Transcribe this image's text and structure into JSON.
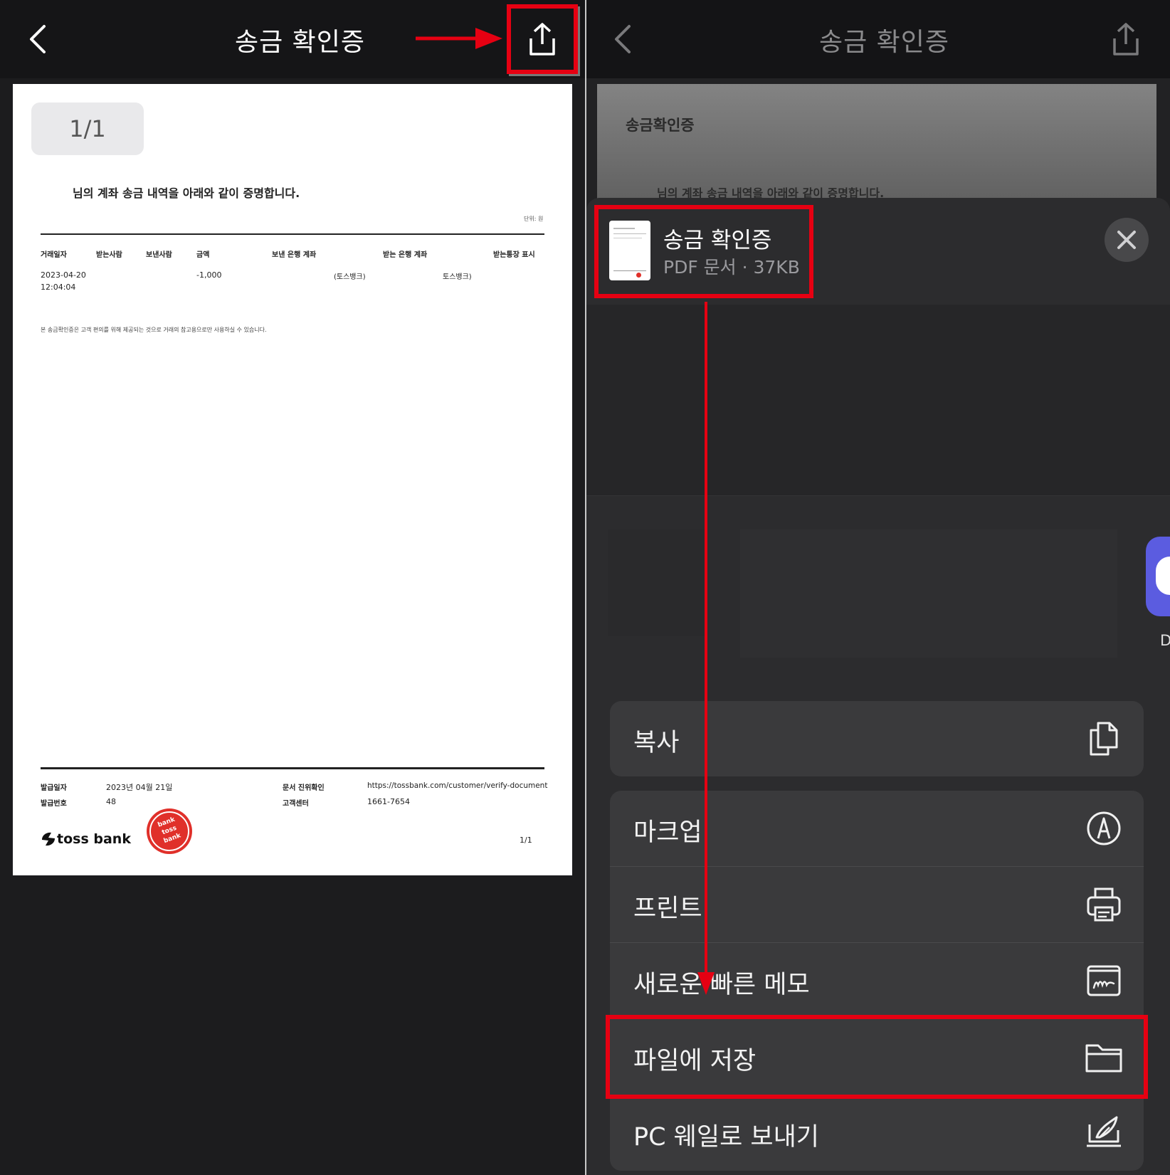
{
  "left_screen": {
    "header": {
      "title": "송금 확인증"
    },
    "document": {
      "page_indicator": "1/1",
      "heading": "님의 계좌 송금 내역을 아래와 같이 증명합니다.",
      "unit_label": "단위: 원",
      "table": {
        "headers": [
          "거래일자",
          "받는사람",
          "보낸사람",
          "금액",
          "보낸 은행 계좌",
          "받는 은행 계좌",
          "받는통장 표시"
        ],
        "row": {
          "date": "2023-04-20",
          "time": "12:04:04",
          "amount": "-1,000",
          "sender_bank": "(토스뱅크)",
          "receiver_bank": "토스뱅크)"
        }
      },
      "notice": "본 송금확인증은 고객 편의를 위해 제공되는 것으로 거래의 참고용으로만 사용하실 수 있습니다.",
      "footer": {
        "issue_date_label": "발급일자",
        "issue_date": "2023년 04월 21일",
        "issue_no_label": "발급번호",
        "issue_no": "48",
        "verify_label": "문서 진위확인",
        "verify_url": "https://tossbank.com/customer/verify-document",
        "cs_label": "고객센터",
        "cs_phone": "1661-7654",
        "brand": "toss bank",
        "seal_text": [
          "bank",
          "toss",
          "bank"
        ],
        "page": "1/1"
      }
    }
  },
  "right_screen": {
    "header": {
      "title": "송금 확인증"
    },
    "preview": {
      "title": "송금확인증",
      "line": "님의 계좌 송금 내역을 아래와 같이 증명합니다."
    },
    "share_sheet": {
      "file_name": "송금 확인증",
      "file_meta": "PDF 문서 · 37KB",
      "side_app_label": "D",
      "actions": [
        {
          "label": "복사",
          "icon": "copy-icon"
        },
        {
          "label": "마크업",
          "icon": "markup-icon"
        },
        {
          "label": "프린트",
          "icon": "printer-icon"
        },
        {
          "label": "새로운 빠른 메모",
          "icon": "quick-note-icon"
        },
        {
          "label": "파일에 저장",
          "icon": "folder-icon"
        },
        {
          "label": "PC 웨일로 보내기",
          "icon": "whale-send-icon"
        }
      ]
    }
  },
  "annotations": {
    "highlight_color": "#e60012"
  }
}
